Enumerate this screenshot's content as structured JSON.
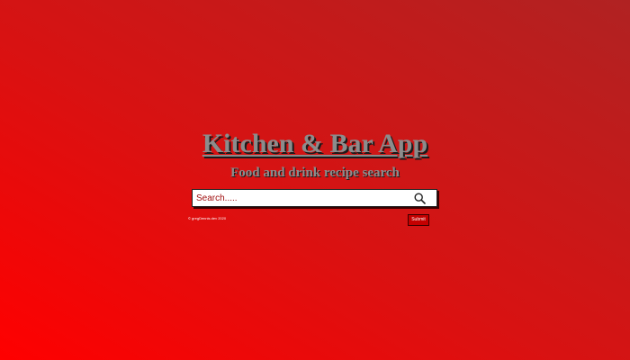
{
  "header": {
    "title": "Kitchen & Bar App",
    "subtitle": "Food and drink recipe search"
  },
  "search": {
    "placeholder": "Search.....",
    "value": "",
    "icon": "search-icon"
  },
  "footer": {
    "copyright": "© gregDennis.dev 2020"
  },
  "actions": {
    "submit_label": "Submit"
  },
  "colors": {
    "background_start": "#ff0000",
    "background_end": "#b02222",
    "title_text": "#8c8c8c",
    "placeholder_text": "#a01010",
    "button_bg": "#c40000"
  }
}
